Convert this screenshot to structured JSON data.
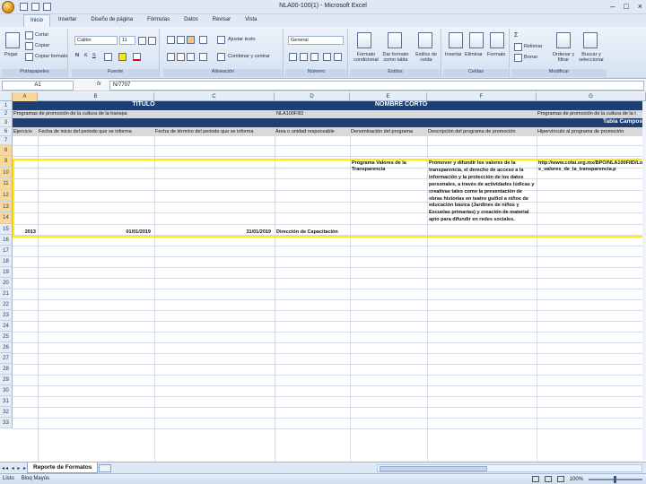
{
  "window": {
    "title": "NLA00-100(1) - Microsoft Excel",
    "controls": [
      "–",
      "□",
      "×"
    ]
  },
  "ribbon": {
    "tabs": [
      "Inicio",
      "Insertar",
      "Diseño de página",
      "Fórmulas",
      "Datos",
      "Revisar",
      "Vista"
    ],
    "clipboard": {
      "paste": "Pegar",
      "cut": "Cortar",
      "copy": "Copiar",
      "format_painter": "Copiar formato",
      "label": "Portapapeles"
    },
    "font": {
      "name": "Calibri",
      "size": "11",
      "label": "Fuente"
    },
    "alignment": {
      "wrap": "Ajustar texto",
      "merge": "Combinar y centrar",
      "label": "Alineación"
    },
    "number": {
      "format": "General",
      "label": "Número"
    },
    "styles": {
      "conditional": "Formato condicional",
      "as_table": "Dar formato como tabla",
      "cell_styles": "Estilos de celda",
      "label": "Estilos"
    },
    "cells": {
      "insert": "Insertar",
      "delete": "Eliminar",
      "format": "Formato",
      "label": "Celdas"
    },
    "editing": {
      "autosum": "Σ",
      "fill": "Rellenar",
      "clear": "Borrar",
      "sort": "Ordenar y filtrar",
      "find": "Buscar y seleccionar",
      "label": "Modificar"
    }
  },
  "formula_bar": {
    "namebox": "A1",
    "fx": "fx",
    "value": "N/7707"
  },
  "columns": [
    "A",
    "B",
    "C",
    "D",
    "E",
    "F",
    "G"
  ],
  "rows": [
    "1",
    "2",
    "3",
    "6",
    "7",
    "8",
    "9",
    "10",
    "11",
    "12",
    "13",
    "14",
    "15",
    "16",
    "17",
    "18",
    "19",
    "20",
    "21",
    "22",
    "23",
    "24",
    "25",
    "26",
    "27",
    "28",
    "29",
    "30",
    "31",
    "32",
    "33"
  ],
  "sheet": {
    "titulo": "TÍTULO",
    "nombre_corto": "NOMBRE CORTO",
    "titulo_value": "Programas de promoción de la cultura de la transpa",
    "nombre_corto_value": "NLA100FIID",
    "row3_g": "Programas de promoción de la cultura de la t",
    "tabla_campos": "Tabla Campos",
    "headers": [
      "Ejercicio",
      "Fecha de inicio del periodo que se informa",
      "Fecha de término del periodo que se informa",
      "Área o unidad responsable",
      "Denominación del programa",
      "Descripción del programa de promoción",
      "Hipervínculo al programa de promoción"
    ],
    "record": {
      "ejercicio": "2013",
      "fecha_inicio": "01/01/2019",
      "fecha_termino": "31/01/2019",
      "area": "Dirección de Capacitación",
      "denominacion": "Programa Valores de la Transparencia",
      "descripcion": "Promover y difundir los valores de la transparencia, el derecho de acceso a la información y la protección de los datos personales, a través de actividades lúdicas y creativas tales como la presentación de obras historias en teatro guiñol a niños de educación básica (Jardines de niños y Escuelas primarias) y creación de material apto para difundir en redes sociales.",
      "hipervinculo": "http://www.cotai.org.mx/BPO/NLA100FIID/Los_valores_de_la_transparencia.p"
    }
  },
  "sheet_tabs": {
    "active": "Reporte de Formatos",
    "nav": "◂◂ ◂ ▸ ▸▸"
  },
  "status": {
    "left": [
      "Listo",
      "Bloq Mayús"
    ],
    "zoom": "100%"
  }
}
